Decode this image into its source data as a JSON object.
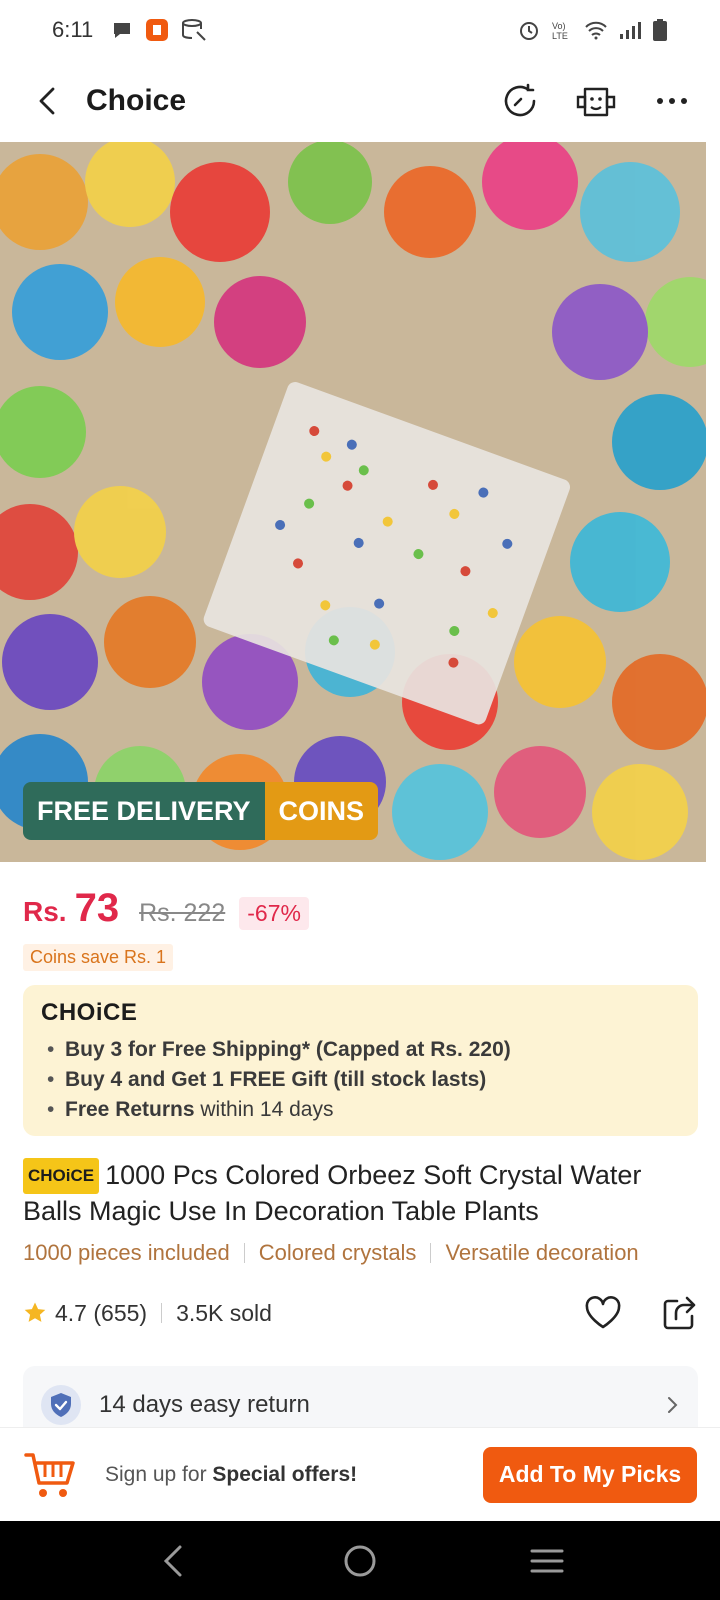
{
  "status_bar": {
    "time": "6:11",
    "network_label": "Vo) LTE"
  },
  "header": {
    "title": "Choice"
  },
  "hero": {
    "badge_free": "FREE DELIVERY",
    "badge_coins": "COINS"
  },
  "price": {
    "currency": "Rs.",
    "amount": "73",
    "original": "Rs. 222",
    "discount": "-67%",
    "coins_save": "Coins save Rs. 1"
  },
  "choice_box": {
    "logo": "CHOiCE",
    "items": [
      {
        "bold": "Buy 3 for  Free Shipping* (Capped at Rs. 220)",
        "rest": ""
      },
      {
        "bold": "Buy 4 and Get 1 FREE Gift (till stock lasts)",
        "rest": ""
      },
      {
        "bold": "Free Returns",
        "rest": " within 14 days"
      }
    ]
  },
  "product": {
    "tag": "CHOiCE",
    "title": "1000 Pcs Colored Orbeez Soft Crystal Water Balls Magic Use In Decoration Table Plants",
    "features": [
      "1000 pieces included",
      "Colored crystals",
      "Versatile decoration"
    ],
    "rating": "4.7 (655)",
    "sold": "3.5K sold"
  },
  "return": {
    "text": "14 days easy return"
  },
  "bottom": {
    "signup_prefix": "Sign up for ",
    "signup_bold": "Special offers!",
    "picks_button": "Add To My Picks"
  },
  "colors": {
    "price": "#e0284a",
    "cta": "#f05a10",
    "free_badge": "#2f6b5a",
    "coins_badge": "#e39a14",
    "choice_bg": "#fdf3d4"
  }
}
